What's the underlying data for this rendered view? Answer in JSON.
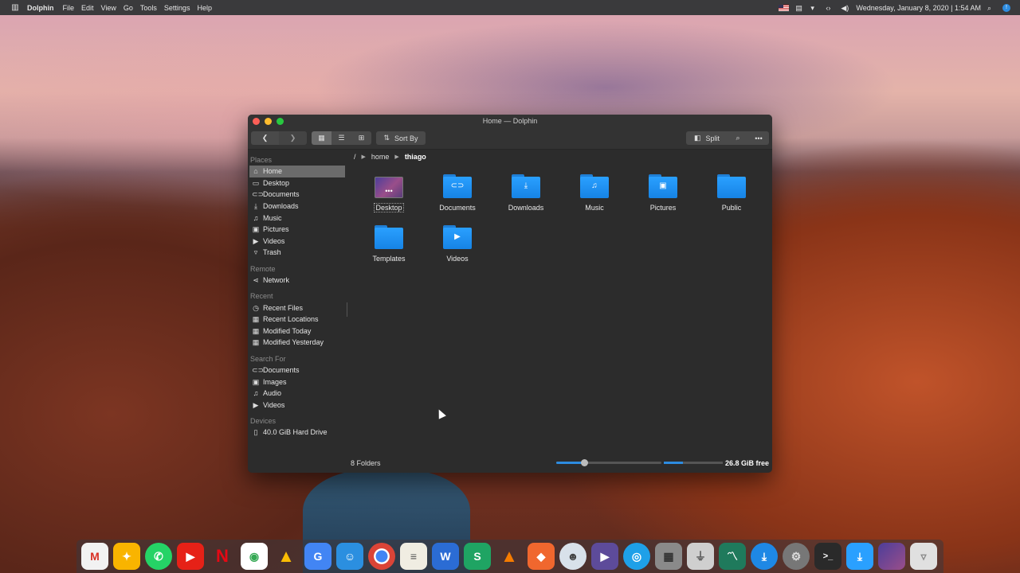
{
  "menubar": {
    "app_name": "Dolphin",
    "menus": [
      "File",
      "Edit",
      "View",
      "Go",
      "Tools",
      "Settings",
      "Help"
    ],
    "datetime": "Wednesday, January 8, 2020 | 1:54 AM",
    "icons": [
      "flag-icon",
      "clipboard-icon",
      "wifi-icon",
      "code-icon",
      "volume-icon",
      "search-icon",
      "notification-icon"
    ]
  },
  "window": {
    "title": "Home — Dolphin",
    "toolbar": {
      "sort_label": "Sort By",
      "split_label": "Split"
    },
    "breadcrumb": {
      "root": "/",
      "parts": [
        "home",
        "thiago"
      ]
    },
    "sidebar": {
      "places_title": "Places",
      "places": [
        "Home",
        "Desktop",
        "Documents",
        "Downloads",
        "Music",
        "Pictures",
        "Videos",
        "Trash"
      ],
      "remote_title": "Remote",
      "remote": [
        "Network"
      ],
      "recent_title": "Recent",
      "recent": [
        "Recent Files",
        "Recent Locations",
        "Modified Today",
        "Modified Yesterday"
      ],
      "search_title": "Search For",
      "search": [
        "Documents",
        "Images",
        "Audio",
        "Videos"
      ],
      "devices_title": "Devices",
      "devices": [
        "40.0 GiB Hard Drive"
      ]
    },
    "folders": [
      "Desktop",
      "Documents",
      "Downloads",
      "Music",
      "Pictures",
      "Public",
      "Templates",
      "Videos"
    ],
    "status": {
      "count": "8 Folders",
      "zoom_fraction": 0.27,
      "used_fraction": 0.33,
      "free_space": "26.8 GiB free"
    }
  },
  "dock": [
    "Gmail",
    "Keep",
    "WhatsApp",
    "YouTube",
    "Netflix",
    "Maps",
    "Drive",
    "Translate",
    "Finder",
    "Chrome",
    "Notes",
    "Word",
    "Sheets",
    "VLC",
    "GitKraken",
    "Ghost",
    "Kdenlive",
    "Browser",
    "Calculator",
    "USB Drive",
    "System Monitor",
    "Downloader",
    "Settings",
    "Terminal",
    "Downloads Folder",
    "Desktop Folder",
    "Trash"
  ]
}
